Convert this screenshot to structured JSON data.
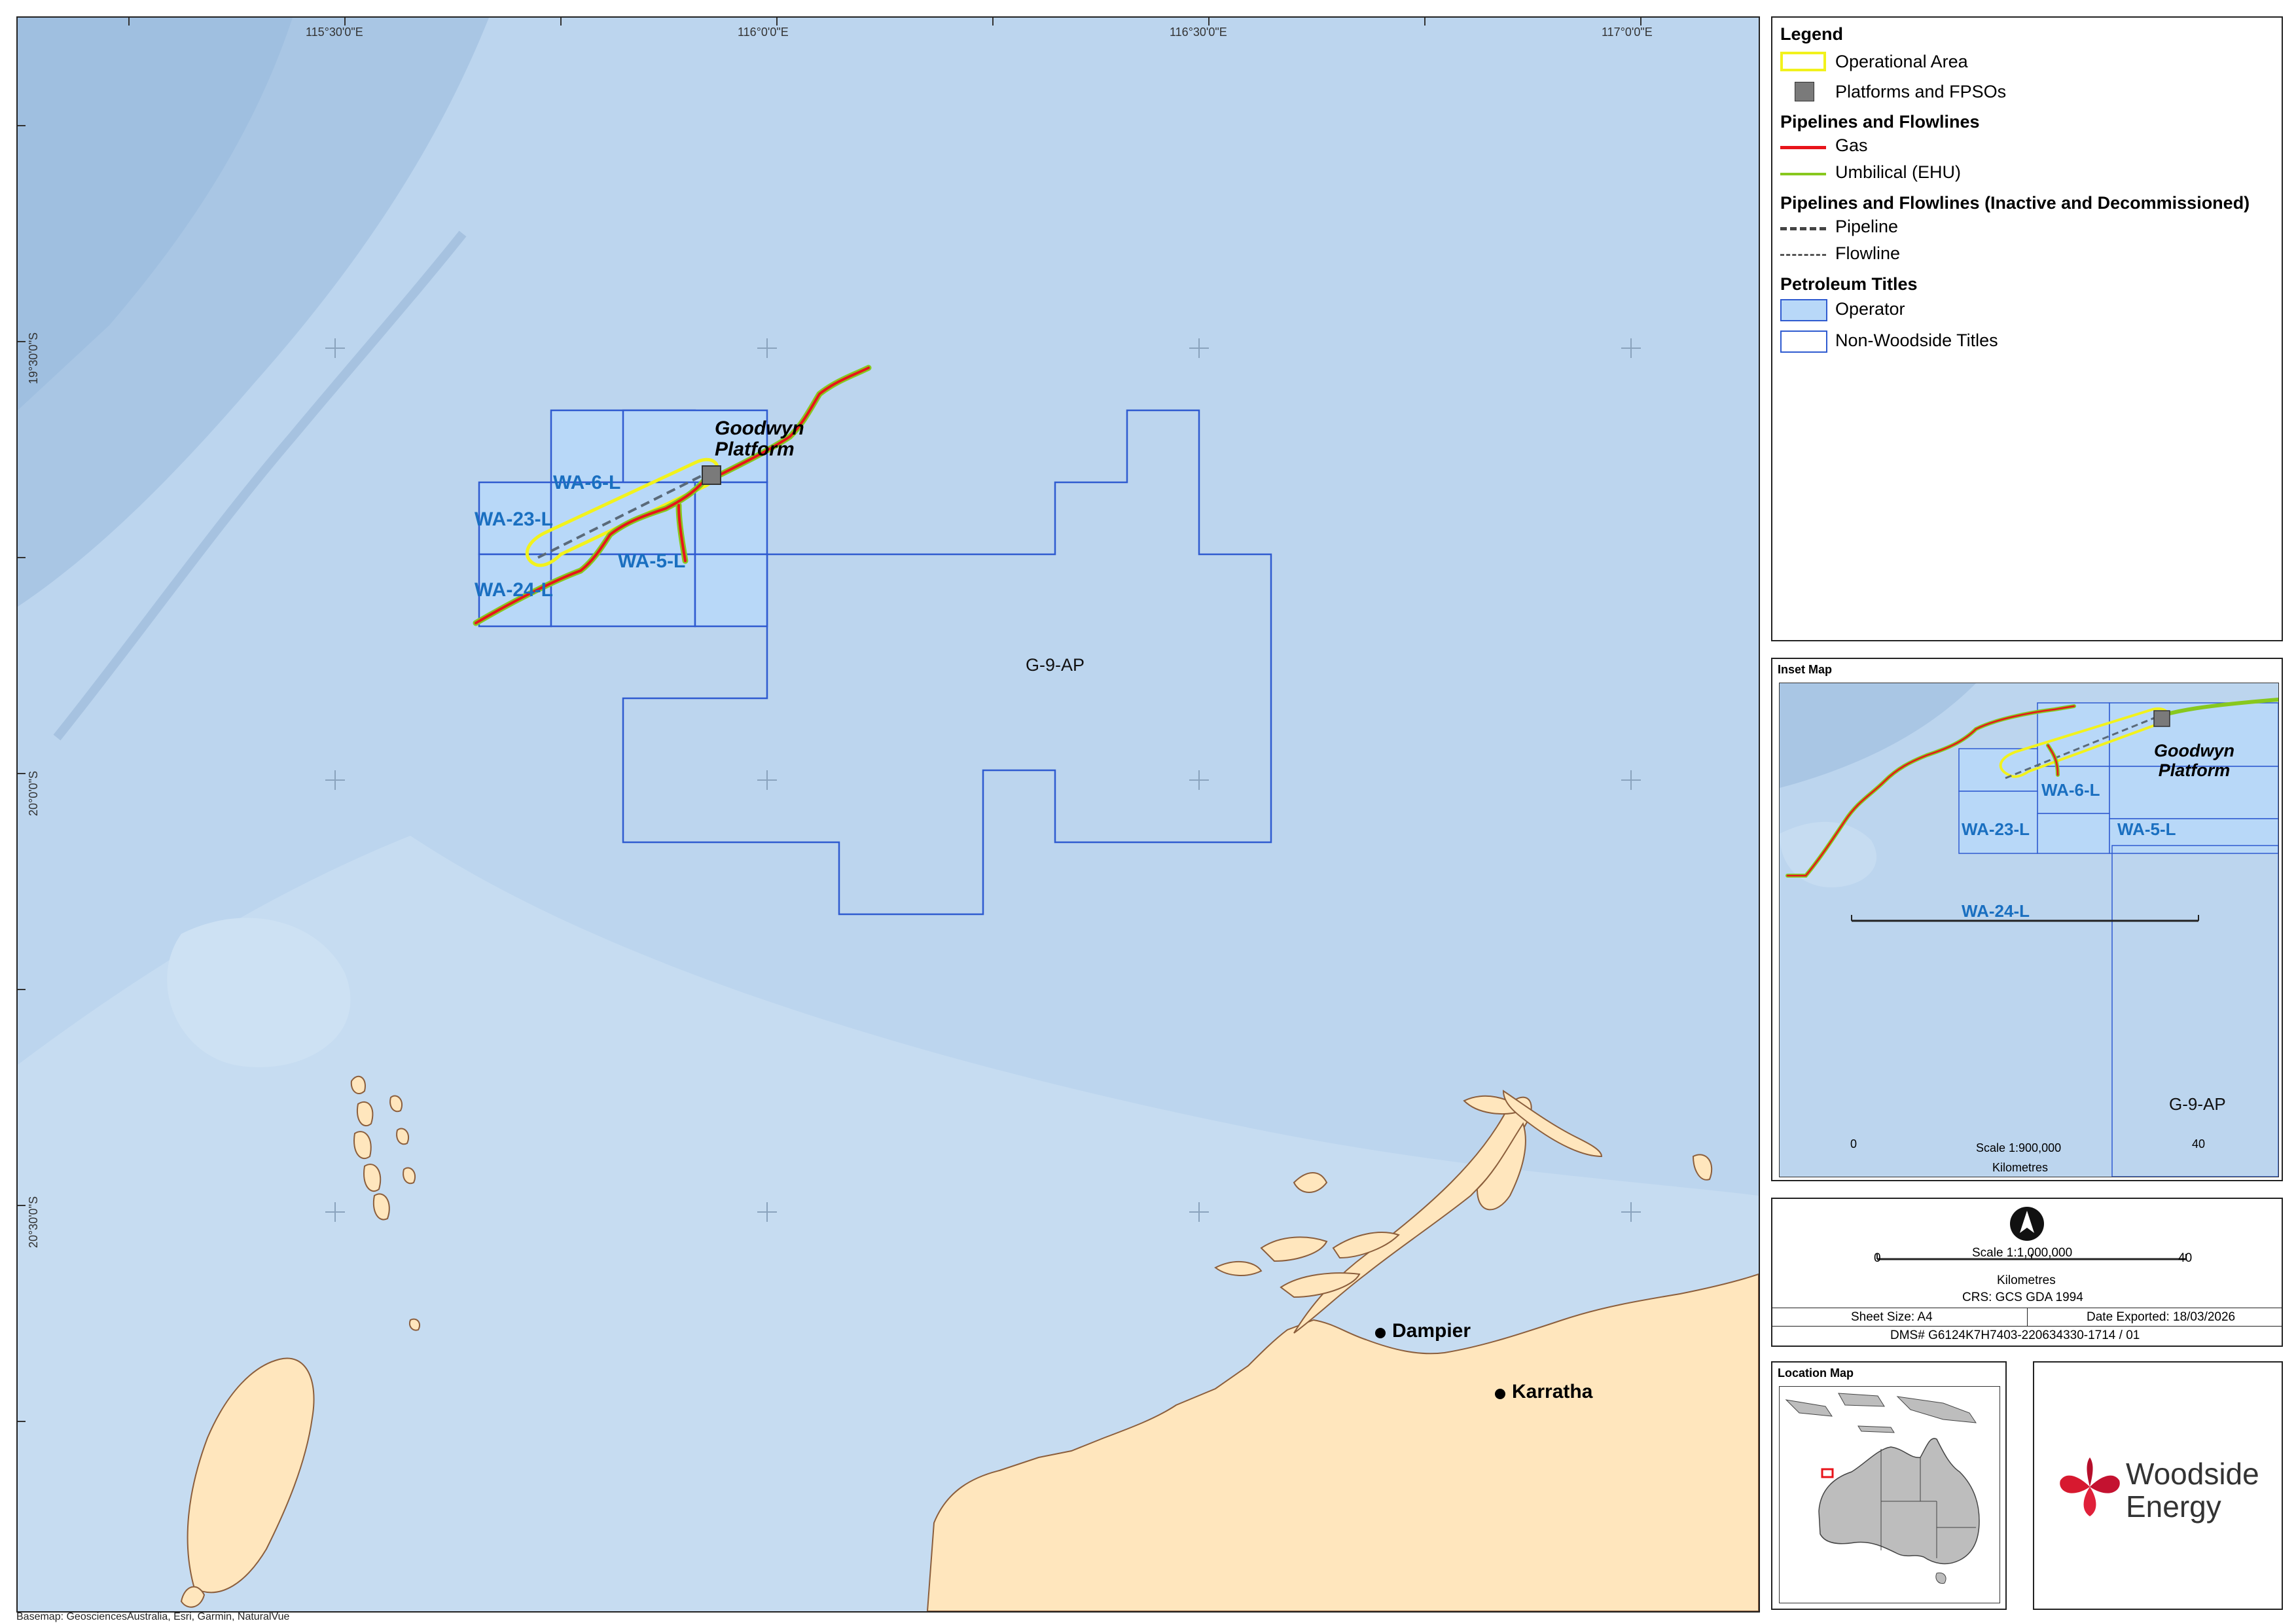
{
  "map": {
    "coords_top": [
      "115°30'0\"E",
      "116°0'0\"E",
      "116°30'0\"E",
      "117°0'0\"E"
    ],
    "coords_left": [
      "19°30'0\"S",
      "20°0'0\"S",
      "20°30'0\"S"
    ],
    "labels": {
      "platform": "Goodwyn Platform",
      "platform_line1": "Goodwyn",
      "platform_line2": "Platform",
      "wa6": "WA-6-L",
      "wa23": "WA-23-L",
      "wa5": "WA-5-L",
      "wa24": "WA-24-L",
      "g9": "G-9-AP",
      "dampier": "Dampier",
      "karratha": "Karratha"
    },
    "basemap_credit": "Basemap: GeosciencesAustralia, Esri, Garmin, NaturalVue",
    "colors": {
      "sea": "#bcd5ee",
      "land": "#ffe6bd",
      "operator_fill": "#b8d8f8",
      "title_outline": "#2f5bd0",
      "gas": "#e8141b",
      "umbilical": "#88c81e",
      "operational_area": "#f2f21c",
      "label_blue": "#1a6fc0"
    }
  },
  "legend": {
    "title": "Legend",
    "operational_area": "Operational Area",
    "platforms": "Platforms and FPSOs",
    "pipelines_heading": "Pipelines and Flowlines",
    "gas": "Gas",
    "umbilical": "Umbilical (EHU)",
    "inactive_heading": "Pipelines and Flowlines (Inactive and Decommissioned)",
    "pipeline": "Pipeline",
    "flowline": "Flowline",
    "titles_heading": "Petroleum Titles",
    "operator": "Operator",
    "non_woodside": "Non-Woodside Titles"
  },
  "inset": {
    "title": "Inset Map",
    "platform_line1": "Goodwyn",
    "platform_line2": "Platform",
    "wa6": "WA-6-L",
    "wa23": "WA-23-L",
    "wa5": "WA-5-L",
    "wa24": "WA-24-L",
    "g9": "G-9-AP",
    "scale_label": "Scale 1:900,000",
    "scale_zero": "0",
    "scale_max": "40",
    "scale_units": "Kilometres"
  },
  "scale_box": {
    "scale_label": "Scale 1:1,000,000",
    "zero": "0",
    "max": "40",
    "units": "Kilometres",
    "crs": "CRS: GCS GDA 1994",
    "sheet_size": "Sheet Size: A4",
    "date_exported": "Date Exported: 18/03/2026",
    "dms": "DMS# G6124K7H7403-220634330-1714 / 01"
  },
  "location_map": {
    "title": "Location Map"
  },
  "logo": {
    "line1": "Woodside",
    "line2": "Energy"
  }
}
